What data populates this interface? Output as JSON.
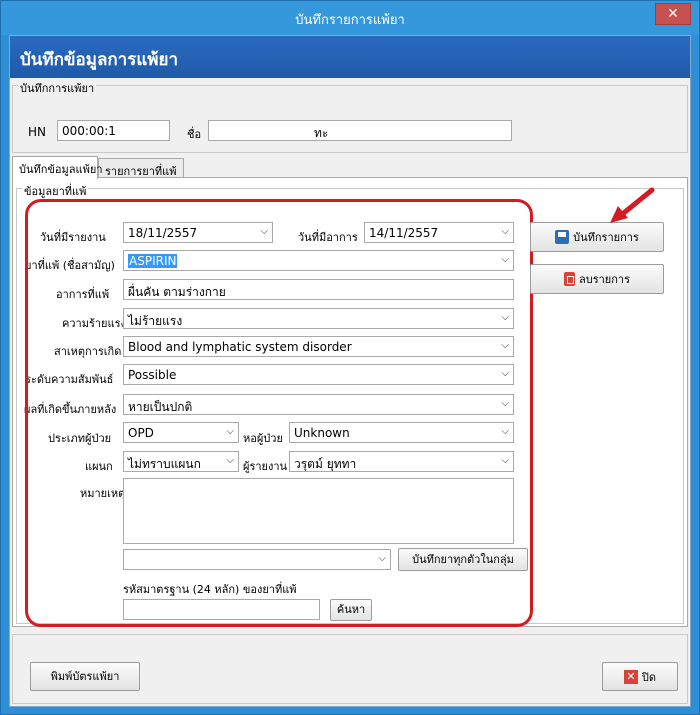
{
  "window": {
    "title": "บันทึกรายการแพ้ยา",
    "close": "✕"
  },
  "header": {
    "title": "บันทึกข้อมูลการแพ้ยา"
  },
  "patient_group": {
    "label": "บันทึกการแพ้ยา",
    "hn_label": "HN",
    "hn_value": "000:00:1",
    "name_label": "ชื่อ",
    "name_value": "ทะ"
  },
  "tabs": [
    {
      "label": "บันทึกข้อมูลแพ้ยา"
    },
    {
      "label": "รายการยาที่แพ้"
    }
  ],
  "drug_group": {
    "label": "ข้อมูลยาที่แพ้"
  },
  "form": {
    "report_date_label": "วันที่มีรายงาน",
    "report_date": "18/11/2557",
    "symptom_date_label": "วันที่มีอาการ",
    "symptom_date": "14/11/2557",
    "drug_label": "ยาที่แพ้ (ชื่อสามัญ)",
    "drug_value": "ASPIRIN",
    "symptom_label": "อาการที่แพ้",
    "symptom_value": "ผื่นคัน ตามร่างกาย",
    "severity_label": "ความร้ายแรง",
    "severity_value": "ไม่ร้ายแรง",
    "cause_label": "สาเหตุการเกิด",
    "cause_value": "Blood and lymphatic system disorder",
    "relation_label": "ระดับความสัมพันธ์",
    "relation_value": "Possible",
    "outcome_label": "ผลที่เกิดขึ้นภายหลัง",
    "outcome_value": "หายเป็นปกติ",
    "patient_type_label": "ประเภทผู้ป่วย",
    "patient_type_value": "OPD",
    "ward_label": "หอผู้ป่วย",
    "ward_value": "Unknown",
    "dept_label": "แผนก",
    "dept_value": "ไม่ทราบแผนก",
    "reporter_label": "ผู้รายงาน",
    "reporter_value": "วรุตม์ ยุททา",
    "note_label": "หมายเหตุ",
    "group_save_button": "บันทึกยาทุกตัวในกลุ่ม",
    "code24_label": "รหัสมาตรฐาน (24 หลัก) ของยาที่แพ้",
    "search_button": "ค้นหา"
  },
  "side_buttons": {
    "save": "บันทึกรายการ",
    "delete": "ลบรายการ"
  },
  "footer": {
    "print_button": "พิมพ์บัตรแพ้ยา",
    "close_button": "ปิด"
  },
  "colors": {
    "title_bar": "#3598dc",
    "header_band": "#2a6ac0",
    "highlight_frame": "#d21c24",
    "selection": "#3399ff"
  }
}
